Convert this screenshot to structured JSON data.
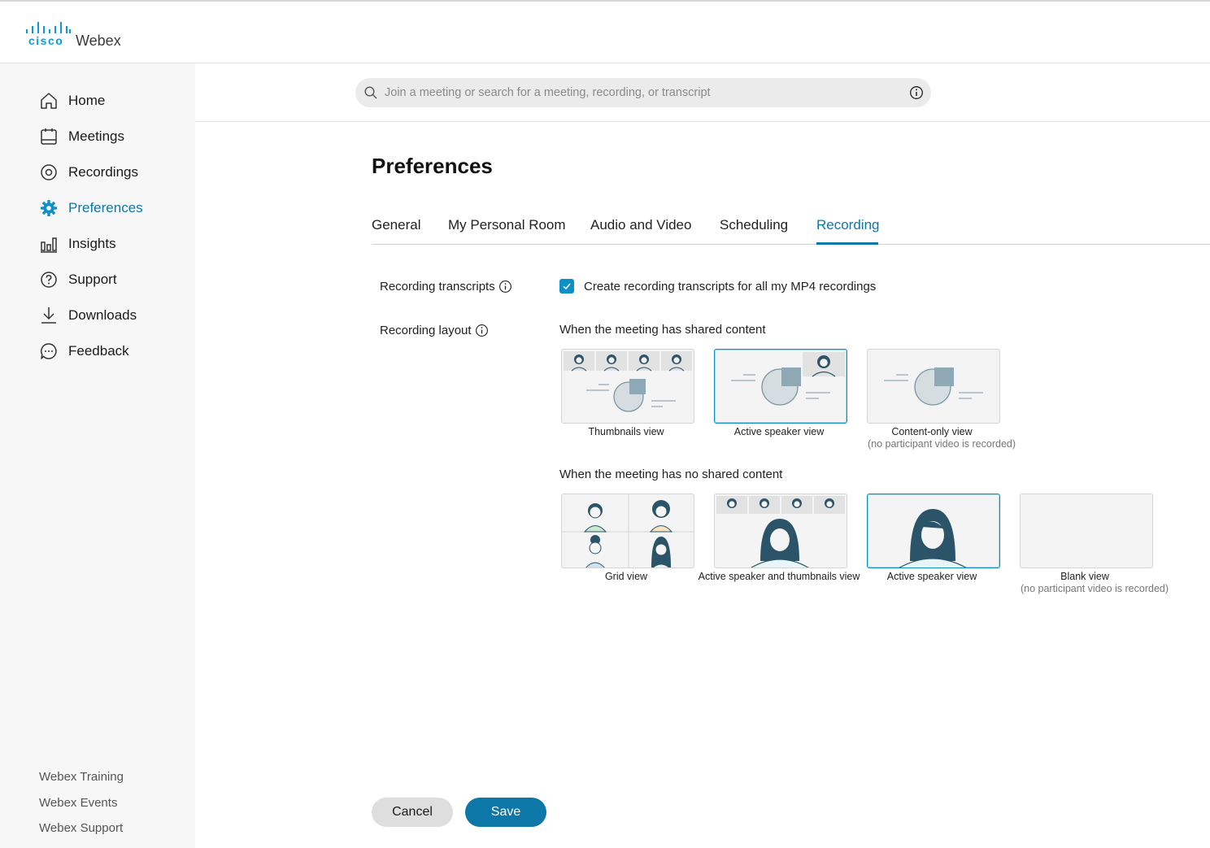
{
  "brand": {
    "wordmark": "cisco",
    "product": "Webex"
  },
  "sidebar": {
    "items": [
      {
        "label": "Home",
        "icon": "home-icon"
      },
      {
        "label": "Meetings",
        "icon": "meetings-icon"
      },
      {
        "label": "Recordings",
        "icon": "recordings-icon"
      },
      {
        "label": "Preferences",
        "icon": "gear-icon",
        "active": true
      },
      {
        "label": "Insights",
        "icon": "insights-icon"
      },
      {
        "label": "Support",
        "icon": "help-icon"
      },
      {
        "label": "Downloads",
        "icon": "download-icon"
      },
      {
        "label": "Feedback",
        "icon": "feedback-icon"
      }
    ],
    "footer_links": [
      "Webex Training",
      "Webex Events",
      "Webex Support"
    ]
  },
  "search": {
    "placeholder": "Join a meeting or search for a meeting, recording, or transcript",
    "value": ""
  },
  "page": {
    "title": "Preferences"
  },
  "tabs": [
    {
      "label": "General"
    },
    {
      "label": "My Personal Room"
    },
    {
      "label": "Audio and Video"
    },
    {
      "label": "Scheduling"
    },
    {
      "label": "Recording",
      "active": true
    }
  ],
  "recording": {
    "transcripts": {
      "label": "Recording transcripts",
      "checkbox_label": "Create recording transcripts for all my MP4 recordings",
      "checked": true
    },
    "layout": {
      "label": "Recording layout",
      "shared_title": "When the meeting has shared content",
      "shared_options": [
        {
          "caption": "Thumbnails view",
          "sub": "",
          "selected": false
        },
        {
          "caption": "Active speaker view",
          "sub": "",
          "selected": true
        },
        {
          "caption": "Content-only view",
          "sub": "(no participant video is recorded)",
          "selected": false
        }
      ],
      "noshared_title": "When the meeting has no shared content",
      "noshared_options": [
        {
          "caption": "Grid view",
          "sub": "",
          "selected": false
        },
        {
          "caption": "Active speaker and thumbnails view",
          "sub": "",
          "selected": false
        },
        {
          "caption": "Active speaker view",
          "sub": "",
          "selected": true
        },
        {
          "caption": "Blank view",
          "sub": "(no participant video is recorded)",
          "selected": false
        }
      ]
    }
  },
  "buttons": {
    "cancel": "Cancel",
    "save": "Save"
  },
  "colors": {
    "accent": "#0d77a8",
    "checkbox": "#0d8fc7",
    "illustration_dark": "#2b5468",
    "illustration_light": "#a9bec9"
  }
}
